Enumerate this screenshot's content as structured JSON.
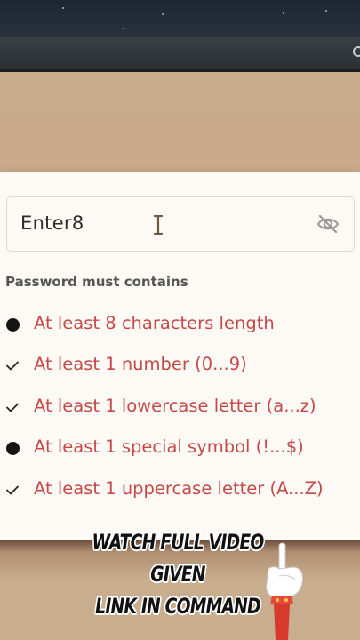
{
  "password_field": {
    "value": "Enter8",
    "visibility_icon": "eye-off-icon"
  },
  "rules": {
    "title": "Password must contains",
    "items": [
      {
        "label": "At least 8 characters length",
        "status": "pending",
        "icon": "bullet-icon"
      },
      {
        "label": "At least 1 number (0...9)",
        "status": "met",
        "icon": "check-icon"
      },
      {
        "label": "At least 1 lowercase letter (a...z)",
        "status": "met",
        "icon": "check-icon"
      },
      {
        "label": "At least 1 special symbol (!...$)",
        "status": "pending",
        "icon": "bullet-icon"
      },
      {
        "label": "At least 1 uppercase letter (A...Z)",
        "status": "met",
        "icon": "check-icon"
      }
    ]
  },
  "overlay": {
    "line1": "WATCH FULL VIDEO GIVEN",
    "line2": "LINK IN COMMAND"
  },
  "colors": {
    "rule_text": "#c44a4a",
    "background": "#c8ae8e",
    "card": "#fdf9f4"
  }
}
